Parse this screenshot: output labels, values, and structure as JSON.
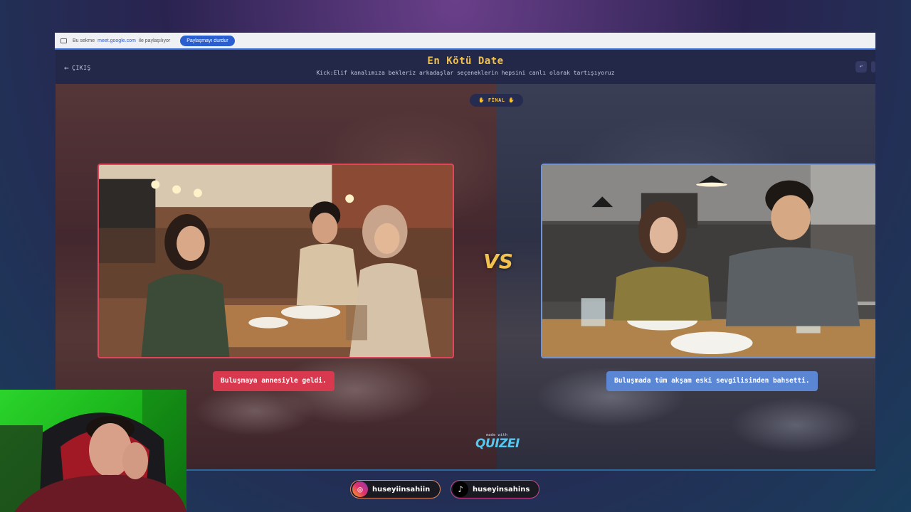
{
  "share_bar": {
    "text_before": "Bu sekme",
    "domain": "meet.google.com",
    "text_after": "ile paylaşılıyor",
    "stop_label": "Paylaşmayı durdur"
  },
  "header": {
    "back_label": "ÇIKIŞ",
    "title": "En Kötü Date",
    "subtitle": "Kick:Elif kanalımıza bekleriz arkadaşlar seçeneklerin hepsini canlı olarak tartışıyoruz"
  },
  "round": {
    "badge": "✋ FİNAL ✋",
    "vs_label": "VS"
  },
  "options": {
    "left": {
      "caption": "Buluşmaya annesiyle geldi.",
      "accent": "#d8394e"
    },
    "right": {
      "caption": "Buluşmada tüm akşam eski sevgilisinden bahsetti.",
      "accent": "#5b86d4"
    }
  },
  "footer": {
    "made_with": "made with",
    "brand": "QUIZEI"
  },
  "socials": {
    "instagram": {
      "handle": "huseyiinsahiin",
      "icon": "instagram-icon"
    },
    "tiktok": {
      "handle": "huseyinsahins",
      "icon": "tiktok-icon"
    }
  }
}
